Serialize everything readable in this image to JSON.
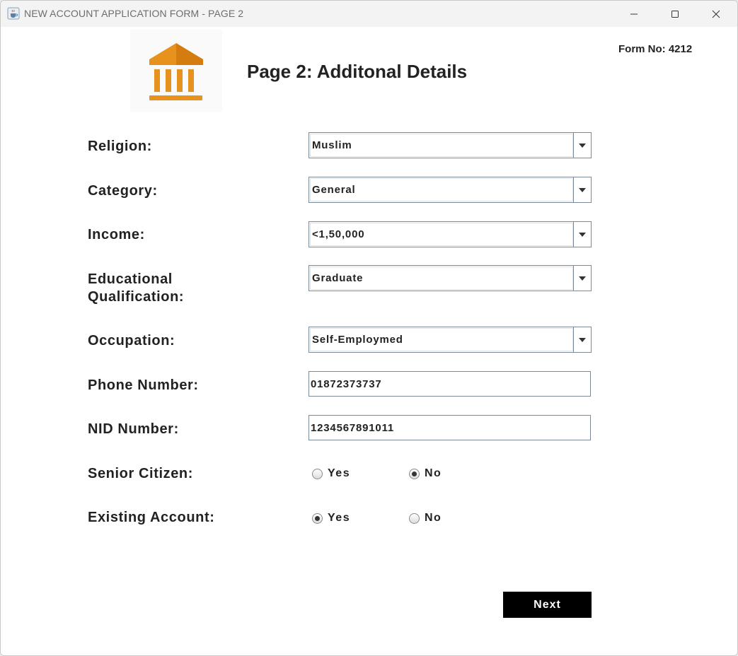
{
  "window": {
    "title": "NEW ACCOUNT APPLICATION FORM - PAGE 2",
    "icon": "java-coffee-icon",
    "controls": [
      "minimize-icon",
      "maximize-icon",
      "close-icon"
    ]
  },
  "header": {
    "logo_icon": "bank-icon",
    "title": "Page 2: Additonal Details",
    "form_no": "Form No: 4212"
  },
  "fields": {
    "religion": {
      "label": "Religion:",
      "value": "Muslim"
    },
    "category": {
      "label": "Category:",
      "value": "General"
    },
    "income": {
      "label": "Income:",
      "value": "<1,50,000"
    },
    "education": {
      "label_line1": "Educational",
      "label_line2": "Qualification:",
      "value": "Graduate"
    },
    "occupation": {
      "label": "Occupation:",
      "value": "Self-Employmed"
    },
    "phone": {
      "label": "Phone Number:",
      "value": "01872373737"
    },
    "nid": {
      "label": "NID Number:",
      "value": "1234567891011"
    },
    "senior_citizen": {
      "label": "Senior Citizen:",
      "yes": "Yes",
      "no": "No",
      "selected": "No"
    },
    "existing_account": {
      "label": "Existing Account:",
      "yes": "Yes",
      "no": "No",
      "selected": "Yes"
    }
  },
  "actions": {
    "next_label": "Next"
  },
  "colors": {
    "accent": "#e8921e",
    "button_bg": "#000000",
    "button_text": "#ffffff"
  }
}
